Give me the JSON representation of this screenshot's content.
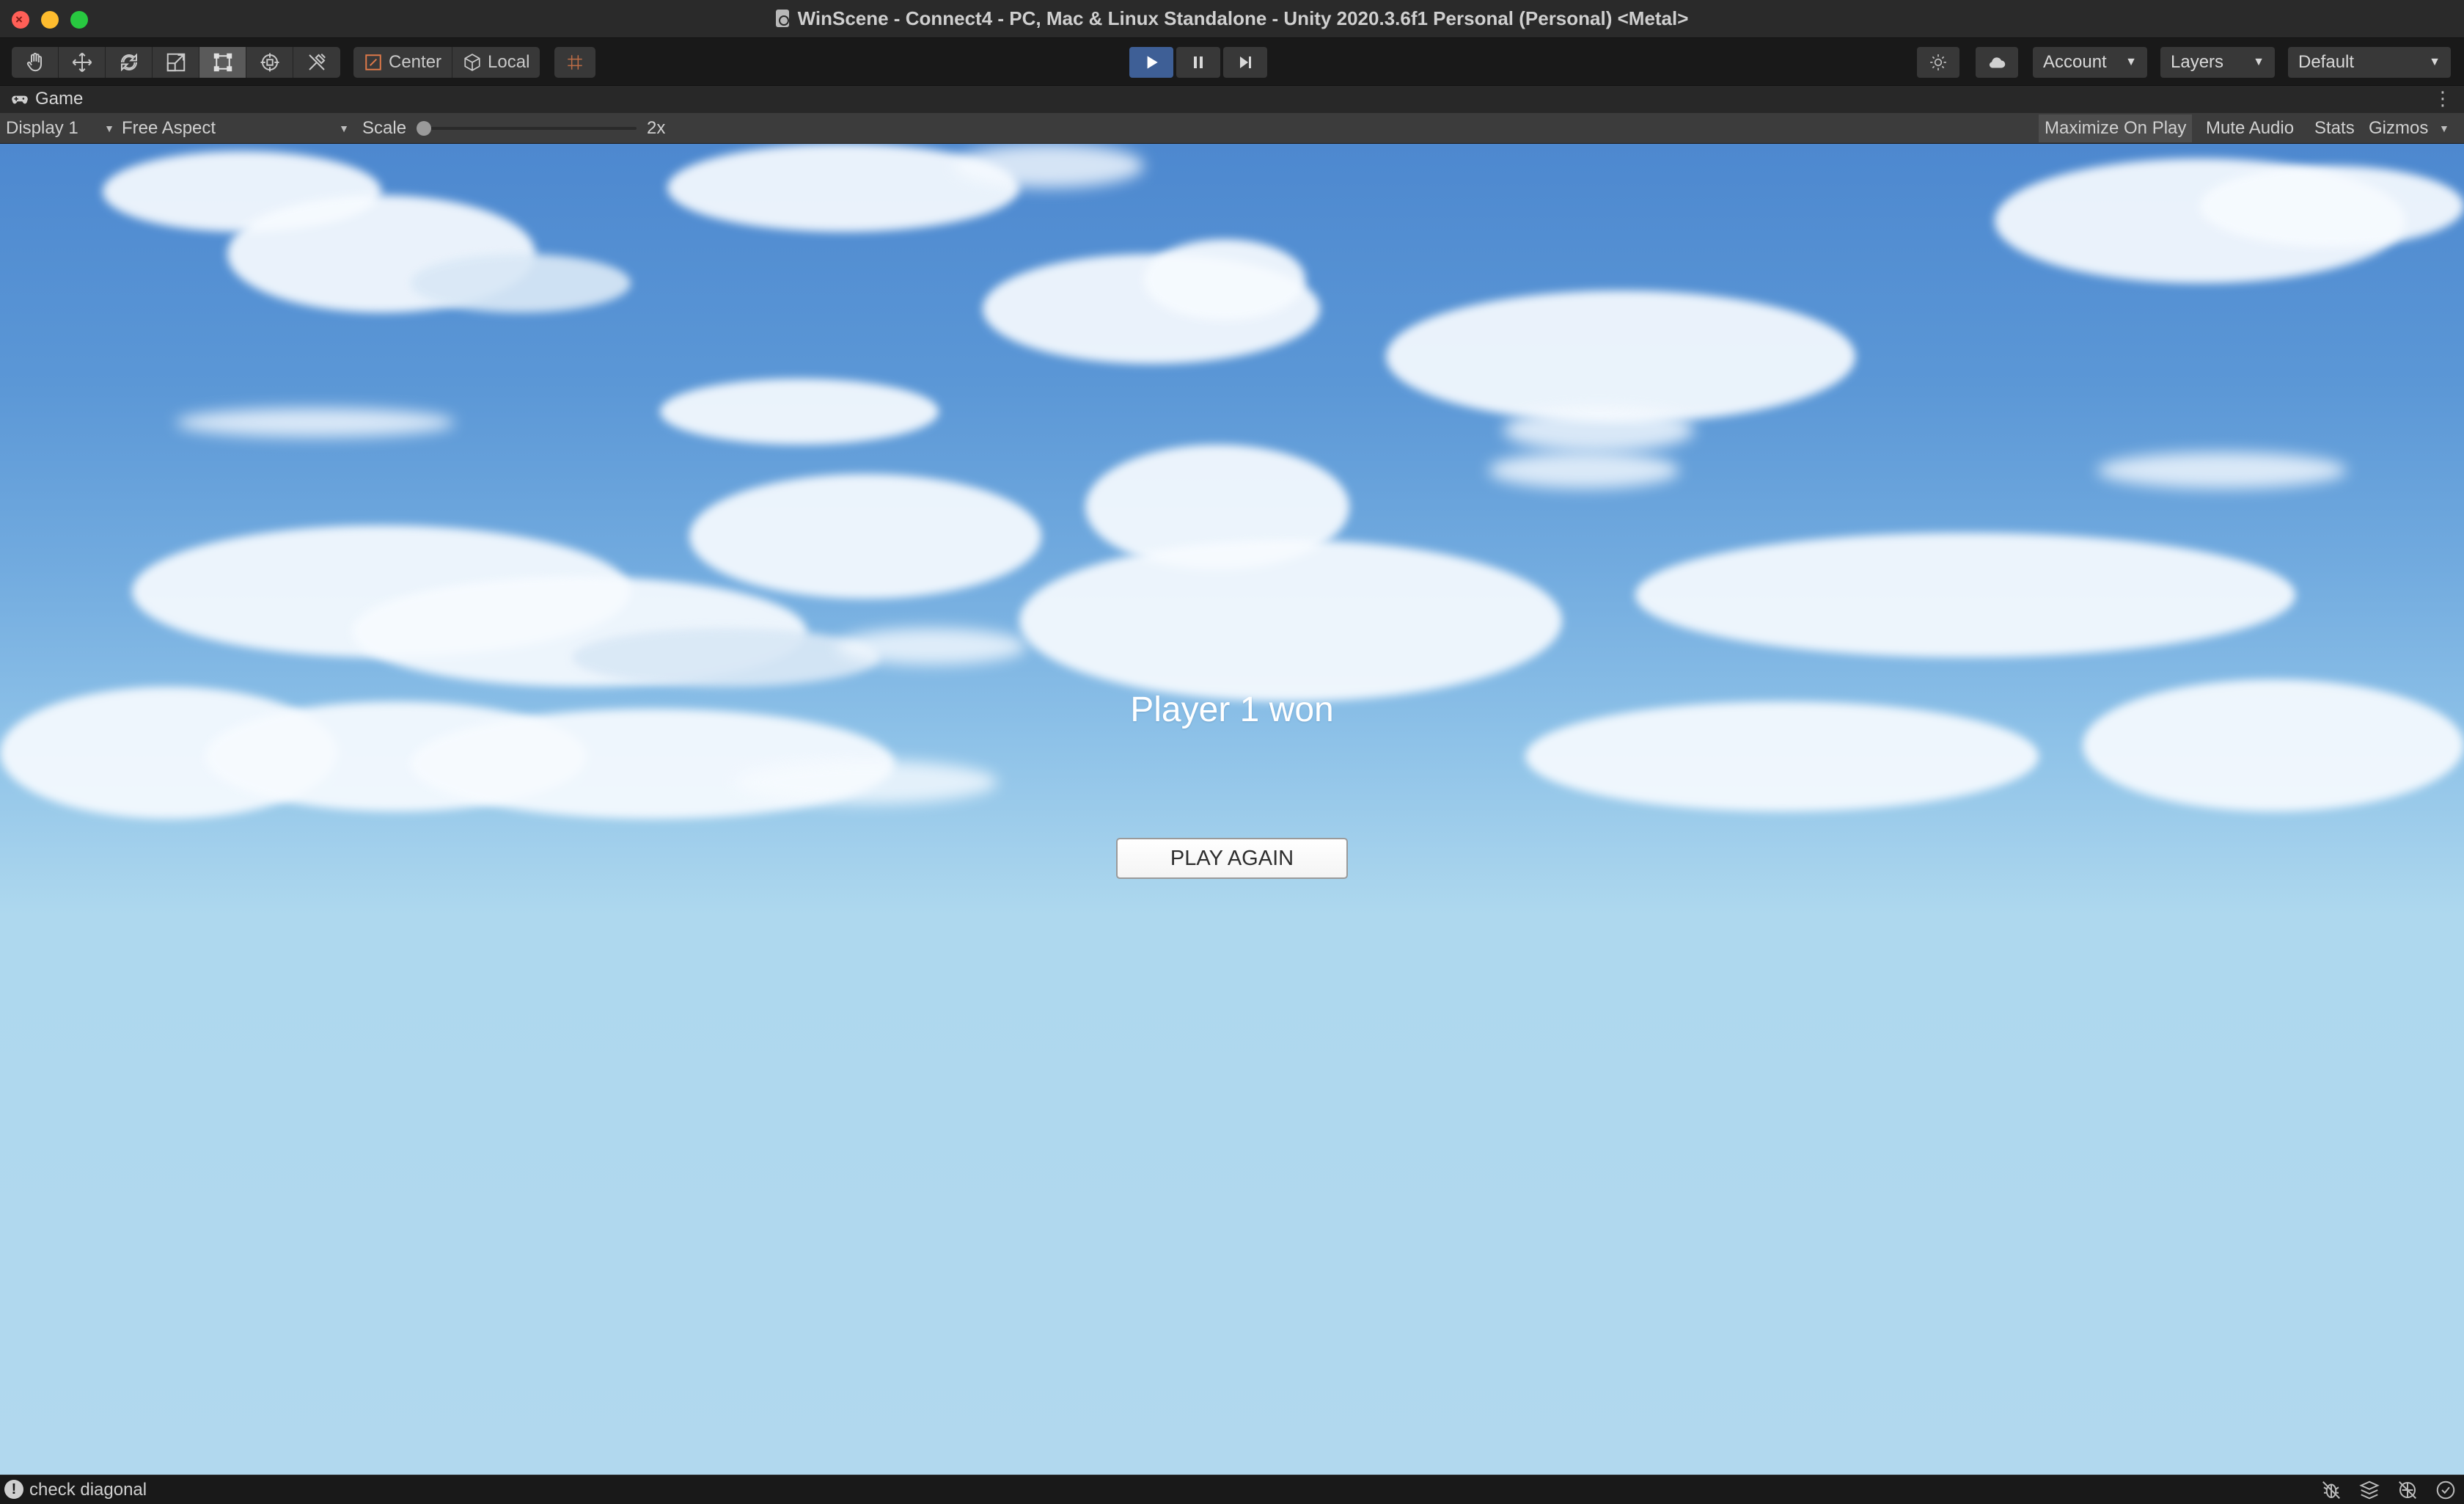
{
  "window": {
    "title": "WinScene - Connect4 - PC, Mac & Linux Standalone - Unity 2020.3.6f1 Personal (Personal) <Metal>"
  },
  "toolbar": {
    "tools": [
      {
        "name": "hand-tool-icon"
      },
      {
        "name": "move-tool-icon"
      },
      {
        "name": "rotate-tool-icon"
      },
      {
        "name": "scale-tool-icon"
      },
      {
        "name": "rect-tool-icon",
        "active": true
      },
      {
        "name": "transform-tool-icon"
      },
      {
        "name": "custom-tools-icon"
      }
    ],
    "pivot_label": "Center",
    "space_label": "Local",
    "account_label": "Account",
    "layers_label": "Layers",
    "layout_label": "Default",
    "play_active": true
  },
  "game_tab": {
    "label": "Game"
  },
  "game_toolbar": {
    "display": "Display 1",
    "aspect": "Free Aspect",
    "scale_label": "Scale",
    "scale_value": "2x",
    "scale_fraction": 0.0,
    "maximize_on_play": "Maximize On Play",
    "mute_audio": "Mute Audio",
    "stats": "Stats",
    "gizmos": "Gizmos"
  },
  "game": {
    "result_text": "Player 1 won",
    "play_again_label": "PLAY AGAIN"
  },
  "status": {
    "message": "check diagonal"
  },
  "colors": {
    "play_active": "#3e5f96",
    "sky_top": "#4d88cf",
    "sky_bottom": "#b1d8ee"
  }
}
